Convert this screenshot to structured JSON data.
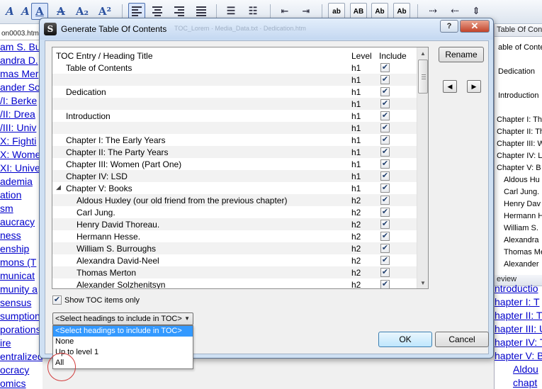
{
  "left_doc": {
    "tab": "on0003.htm",
    "lines": [
      "am S. Bu",
      "andra D.",
      "mas Mer",
      "ander So",
      "/I: Berke",
      "/II: Drea",
      "/III: Univ",
      "X: Fighti",
      "X: Wome",
      "XI: Unive",
      "ademia",
      "ation",
      "sm",
      "aucracy",
      "ness",
      "enship",
      "mons (T",
      "municat",
      "munity a",
      "sensus",
      "sumption",
      "porations",
      "ire",
      "entralized",
      "ocracy",
      "omics"
    ]
  },
  "right_panel": {
    "toc_header": "Table Of Contents",
    "toc_items": [
      "able of Content",
      "Dedication",
      "Introduction",
      "Chapter I: Th",
      "Chapter II: Th",
      "Chapter III: W",
      "Chapter IV: L",
      "Chapter V: B",
      "Aldous Hu",
      "Carl Jung.",
      "Henry Dav",
      "Hermann H",
      "William S.",
      "Alexandra",
      "Thomas Me",
      "Alexander"
    ],
    "preview_header": "eview",
    "preview_items": [
      "ntroductio",
      "hapter I: T",
      "hapter II: T",
      "hapter III: U",
      "hapter IV: T",
      "hapter V: B",
      "Aldou",
      "chapt"
    ]
  },
  "dialog": {
    "title": "Generate Table Of Contents",
    "ghost_text": "TOC_Lorem  ·  Media_Data.txt  ·  Dedication.htm",
    "help_label": "?",
    "close_label": "✕",
    "columns": {
      "entry": "TOC Entry / Heading Title",
      "level": "Level",
      "include": "Include"
    },
    "rows": [
      {
        "title": "Table of Contents",
        "level": "h1",
        "include": true
      },
      {
        "title": "",
        "level": "h1",
        "include": true
      },
      {
        "title": "Dedication",
        "level": "h1",
        "include": true
      },
      {
        "title": "",
        "level": "h1",
        "include": true
      },
      {
        "title": "Introduction",
        "level": "h1",
        "include": true
      },
      {
        "title": "",
        "level": "h1",
        "include": true
      },
      {
        "title": "Chapter I: The Early Years",
        "level": "h1",
        "include": true
      },
      {
        "title": "Chapter II: The Party Years",
        "level": "h1",
        "include": true
      },
      {
        "title": "Chapter III: Women (Part One)",
        "level": "h1",
        "include": true
      },
      {
        "title": "Chapter IV: LSD",
        "level": "h1",
        "include": true
      },
      {
        "title": "Chapter V: Books",
        "level": "h1",
        "include": true,
        "expanded": true
      },
      {
        "title": "Aldous Huxley (our old friend from the previous chapter)",
        "level": "h2",
        "include": true
      },
      {
        "title": "Carl Jung.",
        "level": "h2",
        "include": true
      },
      {
        "title": "Henry David Thoreau.",
        "level": "h2",
        "include": true
      },
      {
        "title": "Hermann Hesse.",
        "level": "h2",
        "include": true
      },
      {
        "title": "William S. Burroughs",
        "level": "h2",
        "include": true
      },
      {
        "title": "Alexandra David-Neel",
        "level": "h2",
        "include": true
      },
      {
        "title": "Thomas Merton",
        "level": "h2",
        "include": true
      },
      {
        "title": "Alexander Solzhenitsyn",
        "level": "h2",
        "include": true
      }
    ],
    "rename_label": "Rename",
    "show_toc_only_label": "Show TOC items only",
    "select_value": "<Select headings to include in TOC>",
    "select_options": [
      "<Select headings to include in TOC>",
      "None",
      "Up to level 1",
      "All"
    ],
    "ok_label": "OK",
    "cancel_label": "Cancel"
  },
  "toolbar": {
    "buttons": [
      "A",
      "A",
      "A",
      "A",
      "A₂",
      "A²",
      "ab",
      "AB",
      "Ab",
      "Ab"
    ]
  },
  "colors": {
    "link": "#0000cc",
    "selection": "#3399ff",
    "annotation": "#d23b3b",
    "frame": "#cfe0f3"
  }
}
